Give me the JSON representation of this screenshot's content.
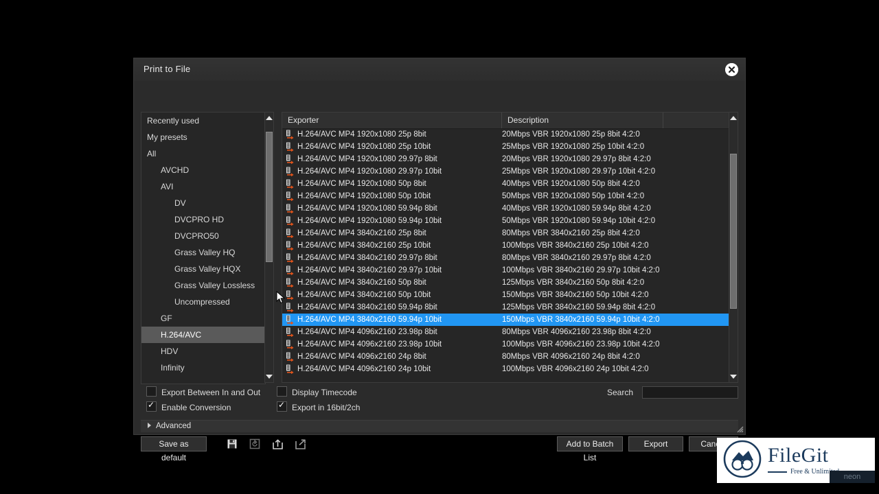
{
  "window": {
    "title": "Print to File",
    "close_icon": "close-circle-icon"
  },
  "tree": {
    "items": [
      {
        "label": "Recently used",
        "depth": 0,
        "selected": false
      },
      {
        "label": "My presets",
        "depth": 0,
        "selected": false
      },
      {
        "label": "All",
        "depth": 0,
        "selected": false
      },
      {
        "label": "AVCHD",
        "depth": 1,
        "selected": false
      },
      {
        "label": "AVI",
        "depth": 1,
        "selected": false
      },
      {
        "label": "DV",
        "depth": 2,
        "selected": false
      },
      {
        "label": "DVCPRO HD",
        "depth": 2,
        "selected": false
      },
      {
        "label": "DVCPRO50",
        "depth": 2,
        "selected": false
      },
      {
        "label": "Grass Valley HQ",
        "depth": 2,
        "selected": false
      },
      {
        "label": "Grass Valley HQX",
        "depth": 2,
        "selected": false
      },
      {
        "label": "Grass Valley Lossless",
        "depth": 2,
        "selected": false
      },
      {
        "label": "Uncompressed",
        "depth": 2,
        "selected": false
      },
      {
        "label": "GF",
        "depth": 1,
        "selected": false
      },
      {
        "label": "H.264/AVC",
        "depth": 1,
        "selected": true
      },
      {
        "label": "HDV",
        "depth": 1,
        "selected": false
      },
      {
        "label": "Infinity",
        "depth": 1,
        "selected": false
      }
    ],
    "scrollbar": {
      "up_icon": "scroll-up-arrow-icon",
      "down_icon": "scroll-down-arrow-icon"
    }
  },
  "list": {
    "columns": [
      "Exporter",
      "Description",
      ""
    ],
    "rows": [
      {
        "exporter": "H.264/AVC MP4 1920x1080 25p 8bit",
        "description": "20Mbps VBR  1920x1080 25p 8bit 4:2:0",
        "selected": false
      },
      {
        "exporter": "H.264/AVC MP4 1920x1080 25p 10bit",
        "description": "25Mbps VBR  1920x1080 25p 10bit 4:2:0",
        "selected": false
      },
      {
        "exporter": "H.264/AVC MP4 1920x1080 29.97p 8bit",
        "description": "20Mbps VBR  1920x1080 29.97p 8bit 4:2:0",
        "selected": false
      },
      {
        "exporter": "H.264/AVC MP4 1920x1080 29.97p 10bit",
        "description": "25Mbps VBR  1920x1080 29.97p 10bit 4:2:0",
        "selected": false
      },
      {
        "exporter": "H.264/AVC MP4 1920x1080 50p 8bit",
        "description": "40Mbps VBR  1920x1080 50p 8bit 4:2:0",
        "selected": false
      },
      {
        "exporter": "H.264/AVC MP4 1920x1080 50p 10bit",
        "description": "50Mbps VBR  1920x1080 50p 10bit 4:2:0",
        "selected": false
      },
      {
        "exporter": "H.264/AVC MP4 1920x1080 59.94p 8bit",
        "description": "40Mbps VBR  1920x1080 59.94p 8bit 4:2:0",
        "selected": false
      },
      {
        "exporter": "H.264/AVC MP4 1920x1080 59.94p 10bit",
        "description": "50Mbps VBR  1920x1080 59.94p 10bit 4:2:0",
        "selected": false
      },
      {
        "exporter": "H.264/AVC MP4 3840x2160 25p 8bit",
        "description": "80Mbps VBR  3840x2160 25p 8bit 4:2:0",
        "selected": false
      },
      {
        "exporter": "H.264/AVC MP4 3840x2160 25p 10bit",
        "description": "100Mbps VBR 3840x2160 25p 10bit 4:2:0",
        "selected": false
      },
      {
        "exporter": "H.264/AVC MP4 3840x2160 29.97p 8bit",
        "description": "80Mbps VBR  3840x2160 29.97p 8bit 4:2:0",
        "selected": false
      },
      {
        "exporter": "H.264/AVC MP4 3840x2160 29.97p 10bit",
        "description": "100Mbps VBR 3840x2160 29.97p 10bit 4:2:0",
        "selected": false
      },
      {
        "exporter": "H.264/AVC MP4 3840x2160 50p 8bit",
        "description": "125Mbps VBR 3840x2160 50p 8bit 4:2:0",
        "selected": false
      },
      {
        "exporter": "H.264/AVC MP4 3840x2160 50p 10bit",
        "description": "150Mbps VBR 3840x2160 50p 10bit 4:2:0",
        "selected": false
      },
      {
        "exporter": "H.264/AVC MP4 3840x2160 59.94p 8bit",
        "description": "125Mbps VBR 3840x2160 59.94p 8bit 4:2:0",
        "selected": false
      },
      {
        "exporter": "H.264/AVC MP4 3840x2160 59.94p 10bit",
        "description": "150Mbps VBR 3840x2160 59.94p 10bit 4:2:0",
        "selected": true
      },
      {
        "exporter": "H.264/AVC MP4 4096x2160 23.98p 8bit",
        "description": "80Mbps VBR  4096x2160 23.98p 8bit 4:2:0",
        "selected": false
      },
      {
        "exporter": "H.264/AVC MP4 4096x2160 23.98p 10bit",
        "description": "100Mbps VBR 4096x2160 23.98p 10bit 4:2:0",
        "selected": false
      },
      {
        "exporter": "H.264/AVC MP4 4096x2160 24p 8bit",
        "description": "80Mbps VBR  4096x2160 24p 8bit 4:2:0",
        "selected": false
      },
      {
        "exporter": "H.264/AVC MP4 4096x2160 24p 10bit",
        "description": "100Mbps VBR 4096x2160 24p 10bit 4:2:0",
        "selected": false
      }
    ],
    "row_icon": "film-strip-export-icon",
    "selection_color": "#2196f3"
  },
  "options": {
    "export_between_in_and_out": {
      "label": "Export Between In and Out",
      "checked": false
    },
    "enable_conversion": {
      "label": "Enable Conversion",
      "checked": true
    },
    "display_timecode": {
      "label": "Display Timecode",
      "checked": false
    },
    "export_in_16bit_2ch": {
      "label": "Export in  16bit/2ch",
      "checked": true
    }
  },
  "search": {
    "label": "Search",
    "value": "",
    "placeholder": ""
  },
  "advanced": {
    "label": "Advanced",
    "expanded": false,
    "caret_icon": "chevron-right-icon"
  },
  "footer": {
    "save_as_default": "Save as default",
    "icons": [
      "save-preset-icon",
      "reset-preset-icon",
      "import-preset-icon",
      "export-preset-icon"
    ],
    "add_to_batch_list": "Add to Batch List",
    "export": "Export",
    "cancel": "Cancel"
  },
  "watermark": {
    "title": "FileGit",
    "subtitle": "Free & Unlimited",
    "corner": "neon"
  }
}
